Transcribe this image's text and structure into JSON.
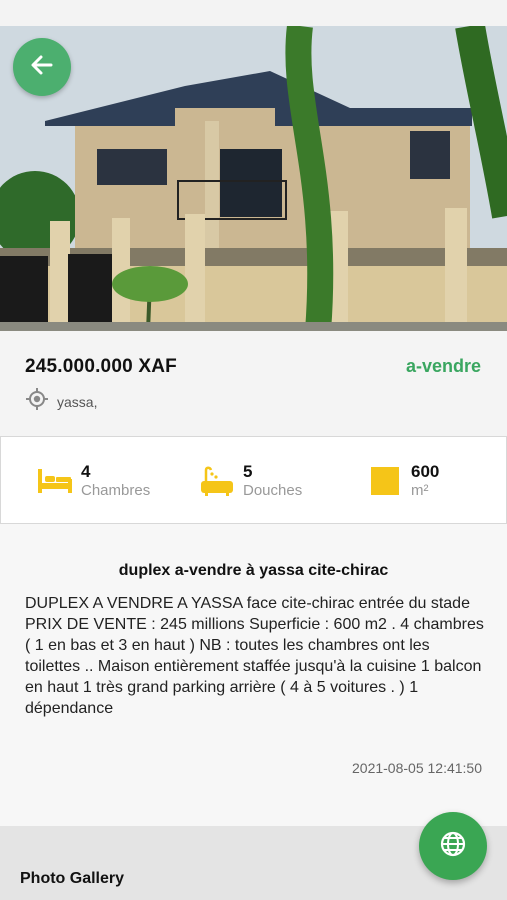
{
  "listing": {
    "price": "245.000.000 XAF",
    "status": "a-vendre",
    "location": "yassa,",
    "title": "duplex a-vendre à yassa cite-chirac",
    "description": "DUPLEX A VENDRE A YASSA face cite-chirac entrée du stade PRIX DE VENTE : 245 millions Superficie : 600 m2 . 4 chambres ( 1 en bas et 3 en haut ) NB : toutes les chambres ont les toilettes .. Maison entièrement staffée jusqu'à la cuisine 1 balcon en haut 1 très grand parking arrière ( 4 à 5 voitures . ) 1 dépendance",
    "date": "2021-08-05 12:41:50"
  },
  "features": {
    "bedrooms": {
      "value": "4",
      "label": "Chambres",
      "icon": "bed-icon"
    },
    "showers": {
      "value": "5",
      "label": "Douches",
      "icon": "bathtub-icon"
    },
    "area": {
      "value": "600",
      "label": "m²",
      "icon": "square-area-icon"
    }
  },
  "gallery": {
    "title": "Photo Gallery"
  },
  "icons": {
    "back": "arrow-left-icon",
    "location": "location-target-icon",
    "fab": "globe-icon"
  },
  "colors": {
    "accent_green": "#3aa660",
    "feature_icon": "#f5c518"
  }
}
